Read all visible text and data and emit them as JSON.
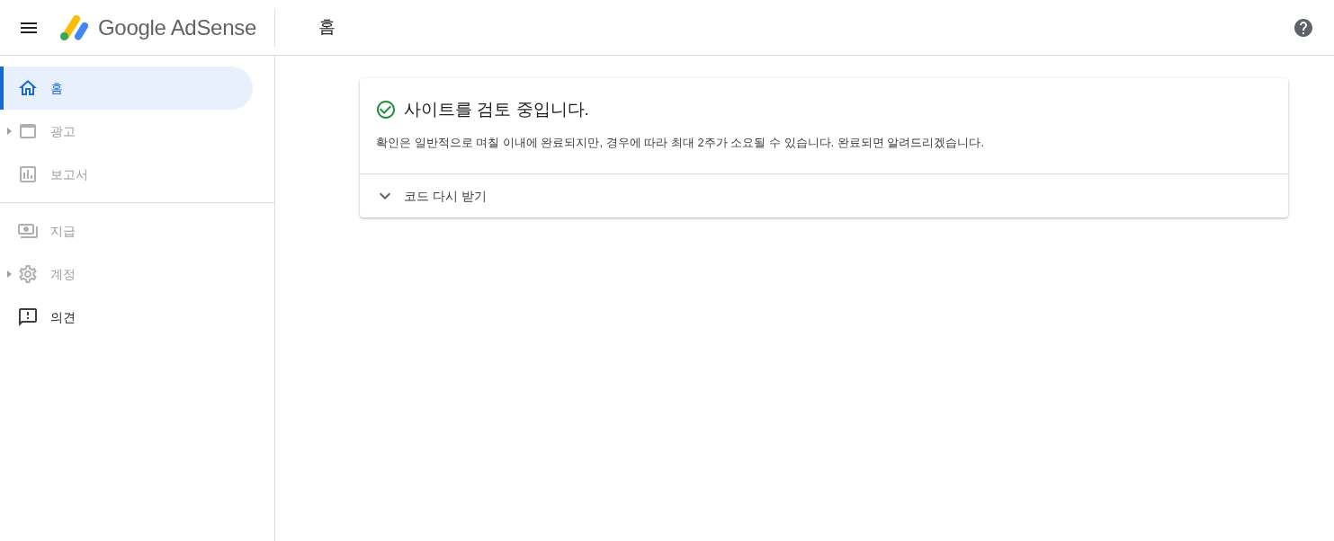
{
  "header": {
    "app_name": "Google AdSense",
    "page_title": "홈"
  },
  "sidebar": {
    "groups": [
      {
        "items": [
          {
            "label": "홈",
            "kind": "home",
            "selected": true,
            "disabled": false,
            "expandable": false
          },
          {
            "label": "광고",
            "kind": "ads",
            "selected": false,
            "disabled": true,
            "expandable": true
          },
          {
            "label": "보고서",
            "kind": "reports",
            "selected": false,
            "disabled": true,
            "expandable": false
          }
        ]
      },
      {
        "items": [
          {
            "label": "지급",
            "kind": "payments",
            "selected": false,
            "disabled": true,
            "expandable": false
          },
          {
            "label": "계정",
            "kind": "account",
            "selected": false,
            "disabled": true,
            "expandable": true
          },
          {
            "label": "의견",
            "kind": "feedback",
            "selected": false,
            "disabled": false,
            "expandable": false
          }
        ]
      }
    ]
  },
  "status_card": {
    "title": "사이트를 검토 중입니다.",
    "message": "확인은 일반적으로 며칠 이내에 완료되지만, 경우에 따라 최대 2주가 소요될 수 있습니다. 완료되면 알려드리겠습니다.",
    "expander": {
      "label": "코드 다시 받기",
      "expanded": false
    }
  }
}
